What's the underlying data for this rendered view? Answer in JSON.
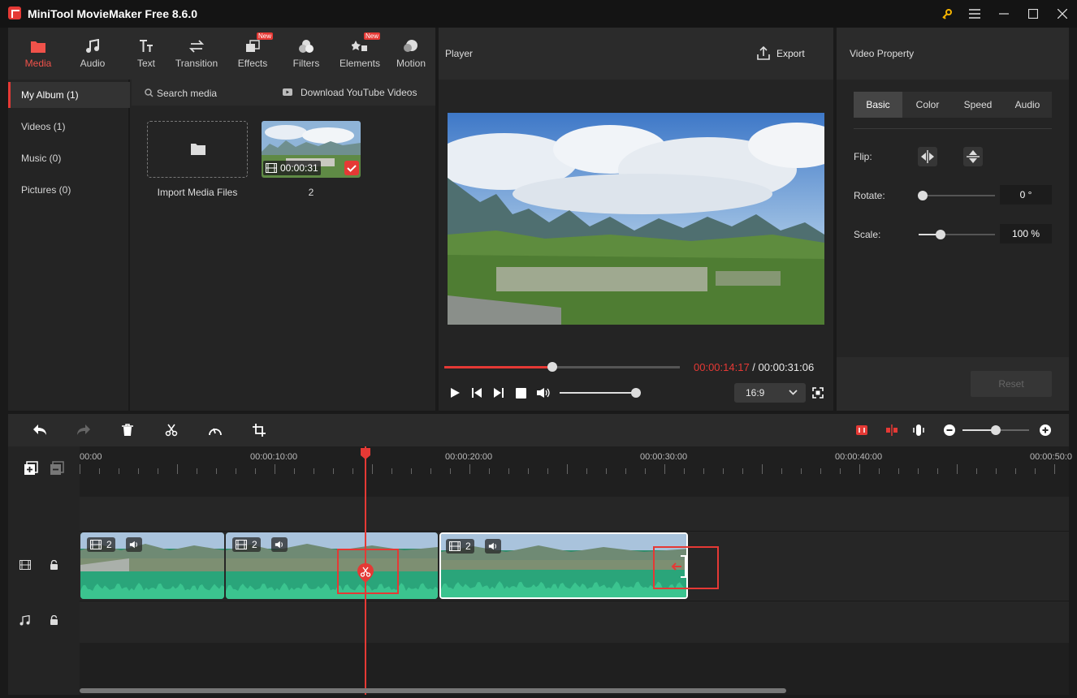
{
  "window": {
    "title": "MiniTool MovieMaker Free 8.6.0"
  },
  "toolbar": {
    "tabs": [
      {
        "label": "Media",
        "icon": "folder-icon",
        "active": true
      },
      {
        "label": "Audio",
        "icon": "music-note-icon"
      },
      {
        "label": "Text",
        "icon": "text-icon"
      },
      {
        "label": "Transition",
        "icon": "transition-arrows-icon"
      },
      {
        "label": "Effects",
        "icon": "effects-icon",
        "badge": "New"
      },
      {
        "label": "Filters",
        "icon": "filters-icon"
      },
      {
        "label": "Elements",
        "icon": "elements-icon",
        "badge": "New"
      },
      {
        "label": "Motion",
        "icon": "motion-icon"
      }
    ]
  },
  "album": {
    "items": [
      {
        "label": "My Album (1)",
        "active": true
      },
      {
        "label": "Videos (1)"
      },
      {
        "label": "Music (0)"
      },
      {
        "label": "Pictures (0)"
      }
    ]
  },
  "media": {
    "search_placeholder": "Search media",
    "download_label": "Download YouTube Videos",
    "import_label": "Import Media Files",
    "clip_duration": "00:00:31",
    "clip_name": "2"
  },
  "player": {
    "title": "Player",
    "export_label": "Export",
    "current_time": "00:00:14:17",
    "separator": " / ",
    "total_time": "00:00:31:06",
    "progress": 0.46,
    "volume": 1.0,
    "aspect_ratio": "16:9"
  },
  "property": {
    "title": "Video Property",
    "tabs": [
      "Basic",
      "Color",
      "Speed",
      "Audio"
    ],
    "active_tab": "Basic",
    "flip_label": "Flip:",
    "rotate_label": "Rotate:",
    "rotate_value": "0 °",
    "scale_label": "Scale:",
    "scale_value": "100 %",
    "rotate_level": 0.0,
    "scale_level": 0.29,
    "reset_label": "Reset"
  },
  "timeline": {
    "ruler_labels": [
      "00:00",
      "00:00:10:00",
      "00:00:20:00",
      "00:00:30:00",
      "00:00:40:00",
      "00:00:50:0"
    ],
    "zoom_level": 0.5,
    "clips": [
      {
        "label": "2"
      },
      {
        "label": "2"
      },
      {
        "label": "2"
      }
    ]
  },
  "colors": {
    "accent": "#e53935",
    "wave": "#2aa57a"
  }
}
